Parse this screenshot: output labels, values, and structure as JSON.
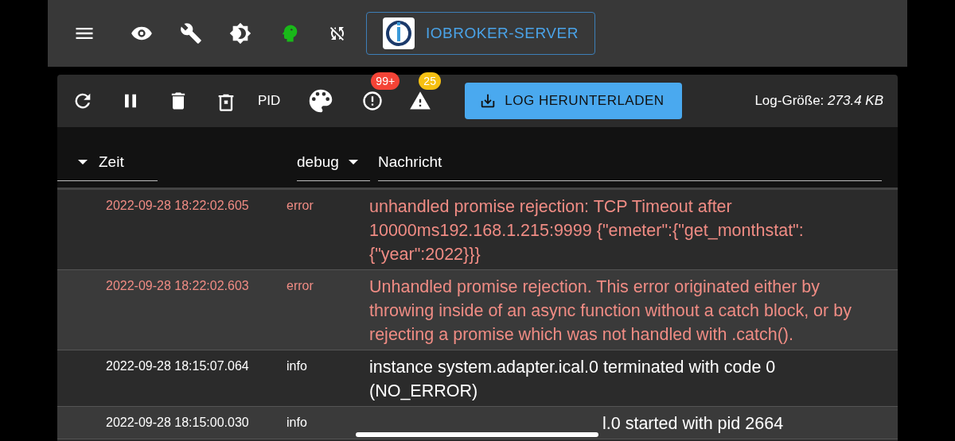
{
  "app_bar": {
    "server_button": "IOBROKER-SERVER"
  },
  "toolbar": {
    "pid_button": "PID",
    "error_badge": "99+",
    "warning_badge": "25",
    "download_button": "LOG HERUNTERLADEN",
    "size_label": "Log-Größe:",
    "size_value": "273.4 KB"
  },
  "table": {
    "columns": [
      "Zeit",
      "debug",
      "Nachricht"
    ],
    "rows": [
      {
        "time": "2022-09-28 18:22:02.605",
        "severity": "error",
        "message": "unhandled promise rejection: TCP Timeout after 10000ms192.168.1.215:9999 {\"emeter\":{\"get_monthstat\":{\"year\":2022}}}"
      },
      {
        "time": "2022-09-28 18:22:02.603",
        "severity": "error",
        "message": "Unhandled promise rejection. This error originated either by throwing inside of an async function without a catch block, or by rejecting a promise which was not handled with .catch()."
      },
      {
        "time": "2022-09-28 18:15:07.064",
        "severity": "info",
        "message": "instance system.adapter.ical.0 terminated with code 0 (NO_ERROR)"
      },
      {
        "time": "2022-09-28 18:15:00.030",
        "severity": "info",
        "message": "l.0 started with pid 2664"
      }
    ]
  }
}
